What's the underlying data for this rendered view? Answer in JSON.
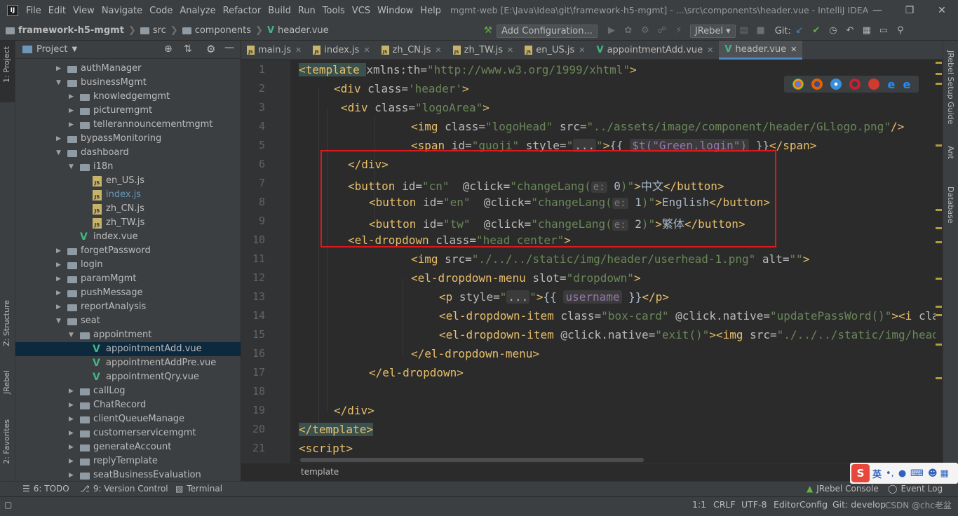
{
  "window": {
    "title": "mgmt-web [E:\\Java\\Idea\\git\\framework-h5-mgmt] - ...\\src\\components\\header.vue - IntelliJ IDEA",
    "menu": [
      "File",
      "Edit",
      "View",
      "Navigate",
      "Code",
      "Analyze",
      "Refactor",
      "Build",
      "Run",
      "Tools",
      "VCS",
      "Window",
      "Help"
    ]
  },
  "breadcrumbs": [
    "framework-h5-mgmt",
    "src",
    "components",
    "header.vue"
  ],
  "toolbar": {
    "add_config": "Add Configuration...",
    "jrebel": "JRebel",
    "git_label": "Git:"
  },
  "left_strip": {
    "project": "1: Project",
    "structure": "Z: Structure",
    "jrebel": "JRebel",
    "favorites": "2: Favorites"
  },
  "right_strip": {
    "jrebel_setup": "JRebel Setup Guide",
    "ant": "Ant",
    "database": "Database"
  },
  "project_panel": {
    "title": "Project",
    "tree": [
      {
        "label": "authManager",
        "type": "folder",
        "depth": 0,
        "expanded": false
      },
      {
        "label": "businessMgmt",
        "type": "folder",
        "depth": 0,
        "expanded": true
      },
      {
        "label": "knowledgemgmt",
        "type": "folder",
        "depth": 1,
        "expanded": false
      },
      {
        "label": "picturemgmt",
        "type": "folder",
        "depth": 1,
        "expanded": false
      },
      {
        "label": "tellerannouncementmgmt",
        "type": "folder",
        "depth": 1,
        "expanded": false
      },
      {
        "label": "bypassMonitoring",
        "type": "folder",
        "depth": 0,
        "expanded": false
      },
      {
        "label": "dashboard",
        "type": "folder",
        "depth": 0,
        "expanded": true
      },
      {
        "label": "i18n",
        "type": "folder",
        "depth": 1,
        "expanded": true
      },
      {
        "label": "en_US.js",
        "type": "js",
        "depth": 2
      },
      {
        "label": "index.js",
        "type": "js",
        "depth": 2,
        "highlight": true
      },
      {
        "label": "zh_CN.js",
        "type": "js",
        "depth": 2
      },
      {
        "label": "zh_TW.js",
        "type": "js",
        "depth": 2
      },
      {
        "label": "index.vue",
        "type": "vue",
        "depth": 1
      },
      {
        "label": "forgetPassword",
        "type": "folder",
        "depth": 0,
        "expanded": false
      },
      {
        "label": "login",
        "type": "folder",
        "depth": 0,
        "expanded": false
      },
      {
        "label": "paramMgmt",
        "type": "folder",
        "depth": 0,
        "expanded": false
      },
      {
        "label": "pushMessage",
        "type": "folder",
        "depth": 0,
        "expanded": false
      },
      {
        "label": "reportAnalysis",
        "type": "folder",
        "depth": 0,
        "expanded": false
      },
      {
        "label": "seat",
        "type": "folder",
        "depth": 0,
        "expanded": true
      },
      {
        "label": "appointment",
        "type": "folder",
        "depth": 1,
        "expanded": true
      },
      {
        "label": "appointmentAdd.vue",
        "type": "vue",
        "depth": 2,
        "selected": true
      },
      {
        "label": "appointmentAddPre.vue",
        "type": "vue",
        "depth": 2
      },
      {
        "label": "appointmentQry.vue",
        "type": "vue",
        "depth": 2
      },
      {
        "label": "callLog",
        "type": "folder",
        "depth": 1,
        "expanded": false
      },
      {
        "label": "ChatRecord",
        "type": "folder",
        "depth": 1,
        "expanded": false
      },
      {
        "label": "clientQueueManage",
        "type": "folder",
        "depth": 1,
        "expanded": false
      },
      {
        "label": "customerservicemgmt",
        "type": "folder",
        "depth": 1,
        "expanded": false
      },
      {
        "label": "generateAccount",
        "type": "folder",
        "depth": 1,
        "expanded": false
      },
      {
        "label": "replyTemplate",
        "type": "folder",
        "depth": 1,
        "expanded": false
      },
      {
        "label": "seatBusinessEvaluation",
        "type": "folder",
        "depth": 1,
        "expanded": false
      }
    ]
  },
  "editor_tabs": [
    {
      "label": "main.js",
      "type": "js"
    },
    {
      "label": "index.js",
      "type": "js"
    },
    {
      "label": "zh_CN.js",
      "type": "js"
    },
    {
      "label": "zh_TW.js",
      "type": "js"
    },
    {
      "label": "en_US.js",
      "type": "js"
    },
    {
      "label": "appointmentAdd.vue",
      "type": "vue"
    },
    {
      "label": "header.vue",
      "type": "vue",
      "active": true
    }
  ],
  "code_lines": [
    [
      [
        "tag",
        "<template "
      ],
      [
        "at",
        "xmlns:th="
      ],
      [
        "val",
        "\"http://www.w3.org/1999/xhtml\""
      ],
      [
        "tag",
        ">"
      ]
    ],
    [
      [
        "tag",
        "<div "
      ],
      [
        "at",
        "class="
      ],
      [
        "val",
        "'header'"
      ],
      [
        "tag",
        ">"
      ]
    ],
    [
      [
        "tag",
        "<div "
      ],
      [
        "at",
        "class="
      ],
      [
        "val",
        "\"logoArea\""
      ],
      [
        "tag",
        ">"
      ]
    ],
    [
      [
        "tag",
        "<img "
      ],
      [
        "at",
        "class="
      ],
      [
        "val",
        "\"logoHead\" "
      ],
      [
        "at",
        "src="
      ],
      [
        "val",
        "\"../assets/image/component/header/GLlogo.png\""
      ],
      [
        "tag",
        "/>"
      ]
    ],
    [
      [
        "tag",
        "<span "
      ],
      [
        "at",
        "id="
      ],
      [
        "val",
        "\"guoji\" "
      ],
      [
        "at",
        "style="
      ],
      [
        "val",
        "\""
      ],
      [
        "fold",
        "..."
      ],
      [
        "val",
        "\""
      ],
      [
        "tag",
        ">"
      ],
      [
        "txt",
        "{{ "
      ],
      [
        "mus",
        "$t(\"Green.login\")"
      ],
      [
        "txt",
        " }}"
      ],
      [
        "tag",
        "</span>"
      ]
    ],
    [
      [
        "tag",
        "</div>"
      ]
    ],
    [
      [
        "tag",
        "<button "
      ],
      [
        "at",
        "id="
      ],
      [
        "val",
        "\"cn\"  "
      ],
      [
        "at",
        "@click="
      ],
      [
        "val",
        "\"changeLang("
      ],
      [
        "hint",
        "e:"
      ],
      [
        "pn",
        " 0"
      ],
      [
        "val",
        ")\""
      ],
      [
        "tag",
        ">"
      ],
      [
        "txt",
        "中文"
      ],
      [
        "tag",
        "</button>"
      ]
    ],
    [
      [
        "tag",
        "<button "
      ],
      [
        "at",
        "id="
      ],
      [
        "val",
        "\"en\"  "
      ],
      [
        "at",
        "@click="
      ],
      [
        "val",
        "\"changeLang("
      ],
      [
        "hint",
        "e:"
      ],
      [
        "pn",
        " 1"
      ],
      [
        "val",
        ")\""
      ],
      [
        "tag",
        ">"
      ],
      [
        "txt",
        "English"
      ],
      [
        "tag",
        "</button>"
      ]
    ],
    [
      [
        "tag",
        "<button "
      ],
      [
        "at",
        "id="
      ],
      [
        "val",
        "\"tw\"  "
      ],
      [
        "at",
        "@click="
      ],
      [
        "val",
        "\"changeLang("
      ],
      [
        "hint",
        "e:"
      ],
      [
        "pn",
        " 2"
      ],
      [
        "val",
        ")\""
      ],
      [
        "tag",
        ">"
      ],
      [
        "txt",
        "繁体"
      ],
      [
        "tag",
        "</button>"
      ]
    ],
    [
      [
        "tag",
        "<el-dropdown "
      ],
      [
        "at",
        "class="
      ],
      [
        "val",
        "\"head center\""
      ],
      [
        "tag",
        ">"
      ]
    ],
    [
      [
        "tag",
        "<img "
      ],
      [
        "at",
        "src="
      ],
      [
        "val",
        "\"./../../static/img/header/userhead-1.png\" "
      ],
      [
        "at",
        "alt="
      ],
      [
        "val",
        "\"\""
      ],
      [
        "tag",
        ">"
      ]
    ],
    [
      [
        "tag",
        "<el-dropdown-menu "
      ],
      [
        "at",
        "slot="
      ],
      [
        "val",
        "\"dropdown\""
      ],
      [
        "tag",
        ">"
      ]
    ],
    [
      [
        "tag",
        "<p "
      ],
      [
        "at",
        "style="
      ],
      [
        "val",
        "\""
      ],
      [
        "fold",
        "..."
      ],
      [
        "val",
        "\""
      ],
      [
        "tag",
        ">"
      ],
      [
        "txt",
        "{{ "
      ],
      [
        "mus",
        "username"
      ],
      [
        "txt",
        " }}"
      ],
      [
        "tag",
        "</p>"
      ]
    ],
    [
      [
        "tag",
        "<el-dropdown-item "
      ],
      [
        "at",
        "class="
      ],
      [
        "val",
        "\"box-card\" "
      ],
      [
        "at",
        "@click.native="
      ],
      [
        "val",
        "\"updatePassWord()\""
      ],
      [
        "tag",
        ">"
      ],
      [
        "tag",
        "<i "
      ],
      [
        "at",
        "class"
      ]
    ],
    [
      [
        "tag",
        "<el-dropdown-item "
      ],
      [
        "at",
        "@click.native="
      ],
      [
        "val",
        "\"exit()\""
      ],
      [
        "tag",
        ">"
      ],
      [
        "tag",
        "<img "
      ],
      [
        "at",
        "src="
      ],
      [
        "val",
        "\"./../../static/img/header"
      ]
    ],
    [
      [
        "tag",
        "</el-dropdown-menu>"
      ]
    ],
    [
      [
        "tag",
        "</el-dropdown>"
      ]
    ],
    [
      [
        "txt",
        ""
      ]
    ],
    [
      [
        "tag",
        "</div>"
      ]
    ],
    [
      [
        "tag",
        "</template>"
      ]
    ],
    [
      [
        "tag",
        "<script>"
      ]
    ]
  ],
  "line_numbers": [
    "1",
    "2",
    "3",
    "4",
    "5",
    "6",
    "7",
    "8",
    "9",
    "10",
    "11",
    "12",
    "13",
    "14",
    "15",
    "16",
    "17",
    "18",
    "19",
    "20",
    "21"
  ],
  "editor_breadcrumb": "template",
  "tool_windows": {
    "todo": "6: TODO",
    "version_control": "9: Version Control",
    "terminal": "Terminal",
    "jrebel_console": "JRebel Console",
    "event_log": "Event Log"
  },
  "status": {
    "position": "1:1",
    "line_sep": "CRLF",
    "encoding": "UTF-8",
    "editor_config": "EditorConfig",
    "git_branch": "Git: develop"
  },
  "ime": {
    "lang": "英"
  },
  "watermark": "CSDN @chc老盆",
  "colors": {
    "accent": "#4a88c7",
    "highlight_box": "#e0181b",
    "vue": "#41b883"
  }
}
